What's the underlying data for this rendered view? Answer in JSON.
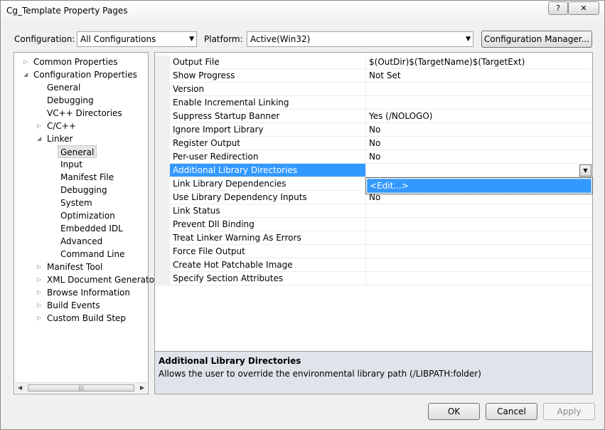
{
  "window": {
    "title": "Cg_Template Property Pages",
    "help_button": "?",
    "close_button": "✕"
  },
  "toolbar": {
    "configuration_label": "Configuration:",
    "configuration_value": "All Configurations",
    "platform_label": "Platform:",
    "platform_value": "Active(Win32)",
    "config_manager_button": "Configuration Manager..."
  },
  "tree": {
    "items": [
      {
        "label": "Common Properties",
        "toggle": "▷"
      },
      {
        "label": "Configuration Properties",
        "toggle": "◢"
      },
      {
        "label": "General"
      },
      {
        "label": "Debugging"
      },
      {
        "label": "VC++ Directories"
      },
      {
        "label": "C/C++",
        "toggle": "▷"
      },
      {
        "label": "Linker",
        "toggle": "◢"
      },
      {
        "label": "General",
        "selected": true
      },
      {
        "label": "Input"
      },
      {
        "label": "Manifest File"
      },
      {
        "label": "Debugging"
      },
      {
        "label": "System"
      },
      {
        "label": "Optimization"
      },
      {
        "label": "Embedded IDL"
      },
      {
        "label": "Advanced"
      },
      {
        "label": "Command Line"
      },
      {
        "label": "Manifest Tool",
        "toggle": "▷"
      },
      {
        "label": "XML Document Generator",
        "toggle": "▷"
      },
      {
        "label": "Browse Information",
        "toggle": "▷"
      },
      {
        "label": "Build Events",
        "toggle": "▷"
      },
      {
        "label": "Custom Build Step",
        "toggle": "▷"
      }
    ],
    "scroll_left": "◀",
    "scroll_right": "▶",
    "scroll_grip": "|||"
  },
  "properties": [
    {
      "name": "Output File",
      "value": "$(OutDir)$(TargetName)$(TargetExt)"
    },
    {
      "name": "Show Progress",
      "value": "Not Set"
    },
    {
      "name": "Version",
      "value": ""
    },
    {
      "name": "Enable Incremental Linking",
      "value": ""
    },
    {
      "name": "Suppress Startup Banner",
      "value": "Yes (/NOLOGO)"
    },
    {
      "name": "Ignore Import Library",
      "value": "No"
    },
    {
      "name": "Register Output",
      "value": "No"
    },
    {
      "name": "Per-user Redirection",
      "value": "No"
    },
    {
      "name": "Additional Library Directories",
      "value": ""
    },
    {
      "name": "Link Library Dependencies",
      "value": ""
    },
    {
      "name": "Use Library Dependency Inputs",
      "value": "No"
    },
    {
      "name": "Link Status",
      "value": ""
    },
    {
      "name": "Prevent Dll Binding",
      "value": ""
    },
    {
      "name": "Treat Linker Warning As Errors",
      "value": ""
    },
    {
      "name": "Force File Output",
      "value": ""
    },
    {
      "name": "Create Hot Patchable Image",
      "value": ""
    },
    {
      "name": "Specify Section Attributes",
      "value": ""
    }
  ],
  "dropdown": {
    "option": "<Edit...>"
  },
  "description": {
    "title": "Additional Library Directories",
    "text": "Allows the user to override the environmental library path (/LIBPATH:folder)"
  },
  "buttons": {
    "ok": "OK",
    "cancel": "Cancel",
    "apply": "Apply"
  },
  "colors": {
    "selection": "#3399ff",
    "description_background": "#dfe3ea",
    "window_background": "#f0f0f0"
  }
}
